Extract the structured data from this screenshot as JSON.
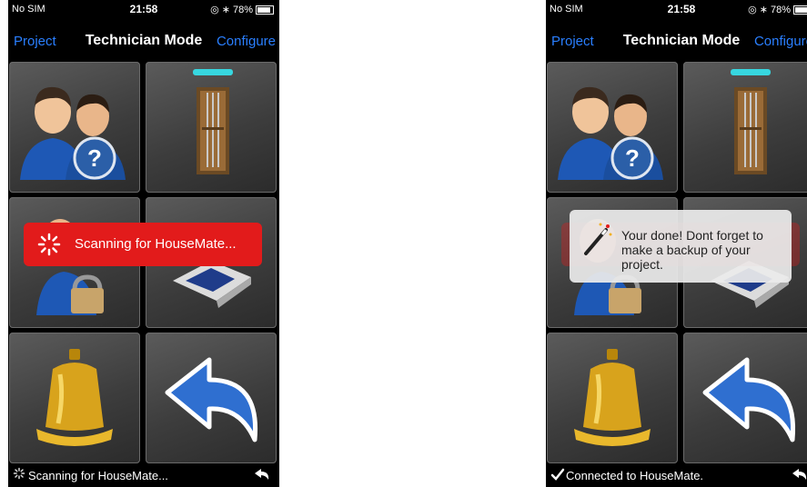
{
  "status_bar": {
    "carrier": "No SIM",
    "time": "21:58",
    "battery": "78%"
  },
  "nav": {
    "left": "Project",
    "title": "Technician Mode",
    "right": "Configure"
  },
  "left_screen": {
    "toast": "Scanning for HouseMate...",
    "footer": "Scanning for HouseMate..."
  },
  "right_screen": {
    "toast": "Your done! Dont forget to make a backup of your project.",
    "footer": "Connected to HouseMate."
  },
  "tiles": [
    {
      "icon": "users-help-icon"
    },
    {
      "icon": "door-icon"
    },
    {
      "icon": "user-lock-icon"
    },
    {
      "icon": "device-icon"
    },
    {
      "icon": "bell-icon"
    },
    {
      "icon": "back-arrow-icon"
    }
  ],
  "colors": {
    "link": "#2a7fff",
    "toast_red": "#e21b1b",
    "indicator": "#37d7e0"
  }
}
